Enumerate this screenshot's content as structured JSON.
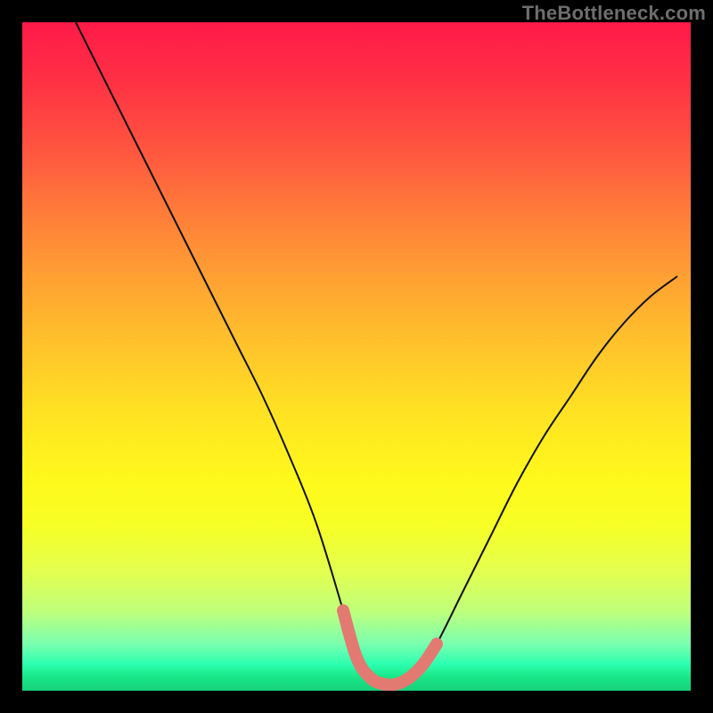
{
  "watermark": "TheBottleneck.com",
  "colors": {
    "gradient_top": "#ff1a49",
    "gradient_mid": "#ffe123",
    "gradient_bottom": "#17d17b",
    "curve": "#111111",
    "highlight": "#e27a72",
    "frame": "#000000"
  },
  "chart_data": {
    "type": "line",
    "title": "",
    "xlabel": "",
    "ylabel": "",
    "xlim": [
      0,
      100
    ],
    "ylim": [
      0,
      100
    ],
    "grid": false,
    "series": [
      {
        "name": "bottleneck-curve",
        "x": [
          8,
          12,
          16,
          20,
          24,
          28,
          32,
          36,
          40,
          44,
          48,
          50,
          52,
          54,
          56,
          58,
          60,
          62,
          66,
          70,
          74,
          78,
          82,
          86,
          90,
          94,
          98
        ],
        "values": [
          100,
          92,
          84,
          76,
          68,
          60,
          52,
          44,
          35,
          25,
          12,
          5,
          2,
          1,
          1,
          2,
          4,
          7,
          15,
          23,
          31,
          38,
          44,
          50,
          55,
          59,
          62
        ]
      }
    ],
    "highlight": {
      "name": "optimal-zone",
      "x": [
        48,
        50,
        52,
        54,
        56,
        58,
        60,
        62
      ],
      "values": [
        12,
        5,
        2,
        1,
        1,
        2,
        4,
        7
      ]
    }
  }
}
